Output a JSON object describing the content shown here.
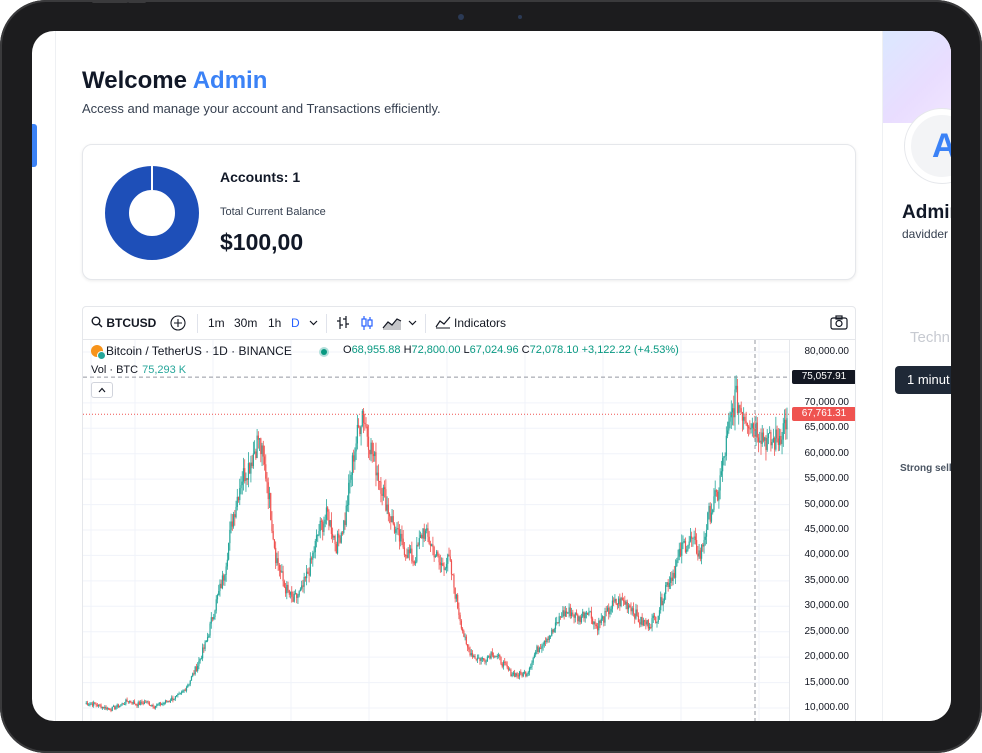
{
  "welcome": {
    "greeting": "Welcome",
    "name": "Admin",
    "subtitle": "Access and manage your account and Transactions efficiently."
  },
  "summary": {
    "accounts_label": "Accounts: 1",
    "balance_label": "Total Current Balance",
    "balance_value": "$100,00",
    "donut_color": "#1e4fb8"
  },
  "chart_toolbar": {
    "symbol": "BTCUSD",
    "intervals": [
      "1m",
      "30m",
      "1h",
      "D"
    ],
    "active_interval": "D",
    "indicators_label": "Indicators"
  },
  "chart_header": {
    "title": "Bitcoin / TetherUS · 1D · BINANCE",
    "open_label": "O",
    "open": "68,955.88",
    "high_label": "H",
    "high": "72,800.00",
    "low_label": "L",
    "low": "67,024.96",
    "close_label": "C",
    "close": "72,078.10",
    "change": "+3,122.22 (+4.53%)",
    "volume_label": "Vol · BTC",
    "volume_value": "75,293 K"
  },
  "chart_data": {
    "type": "candlestick",
    "symbol": "BTCUSD",
    "ylim": [
      9000,
      82000
    ],
    "yticks": [
      "80,000.00",
      "70,000.00",
      "65,000.00",
      "60,000.00",
      "55,000.00",
      "50,000.00",
      "45,000.00",
      "40,000.00",
      "35,000.00",
      "30,000.00",
      "25,000.00",
      "20,000.00",
      "15,000.00",
      "10,000.00"
    ],
    "ytick_values": [
      80000,
      70000,
      65000,
      60000,
      55000,
      50000,
      45000,
      40000,
      35000,
      30000,
      25000,
      20000,
      15000,
      10000
    ],
    "crosshair_price": "75,057.91",
    "crosshair_value": 75057.91,
    "last_price": "67,761.31",
    "last_value": 67761.31,
    "up_color": "#26a69a",
    "down_color": "#ef5350",
    "close_series": [
      11000,
      10800,
      10200,
      9800,
      10500,
      11500,
      10700,
      11200,
      10400,
      10900,
      11800,
      12500,
      15000,
      18500,
      23000,
      30000,
      36000,
      47000,
      55000,
      58000,
      63000,
      55000,
      40000,
      34000,
      31000,
      33000,
      38000,
      45000,
      48000,
      42000,
      47000,
      60000,
      68500,
      61000,
      55000,
      49000,
      44000,
      41000,
      39000,
      45000,
      42000,
      38000,
      39000,
      30000,
      22000,
      20000,
      19500,
      21000,
      19200,
      17000,
      16500,
      17000,
      21000,
      23500,
      25000,
      28500,
      29000,
      27500,
      29500,
      26000,
      28000,
      30500,
      31000,
      30000,
      27000,
      26500,
      28000,
      34000,
      37000,
      42000,
      43000,
      40000,
      48000,
      52000,
      62000,
      71000,
      68000,
      66000,
      64000,
      62000,
      63000,
      67000
    ]
  },
  "profile": {
    "initial": "A",
    "name": "Admin",
    "email": "davidder",
    "technical_label": "Techn",
    "interval_label": "1 minut",
    "signal_label": "Strong sell"
  }
}
